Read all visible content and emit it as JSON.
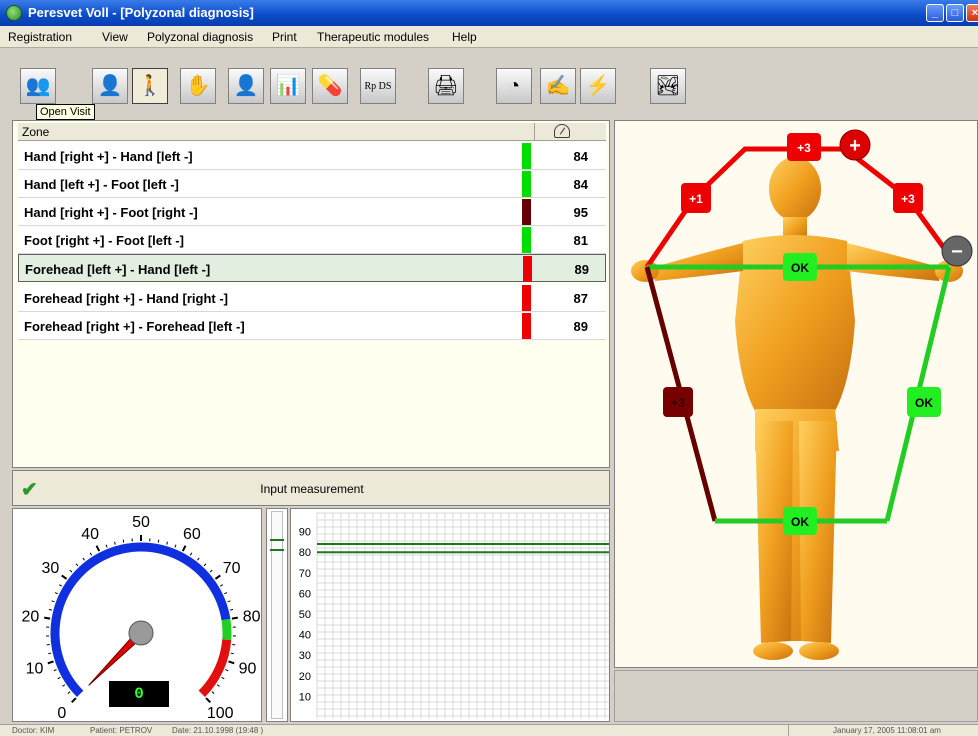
{
  "window": {
    "title": "Peresvet Voll - [Polyzonal diagnosis]"
  },
  "menu": [
    "Registration",
    "View",
    "Polyzonal diagnosis",
    "Print",
    "Therapeutic modules",
    "Help"
  ],
  "toolbar": {
    "tooltip": "Open Visit",
    "buttons": [
      {
        "name": "open-visit-icon",
        "glyph": "👥"
      },
      {
        "name": "patient-icon",
        "glyph": "👤"
      },
      {
        "name": "figure-icon",
        "glyph": "🚶"
      },
      {
        "name": "hand-icon",
        "glyph": "✋"
      },
      {
        "name": "head-profile-icon",
        "glyph": "👤"
      },
      {
        "name": "chart-icon",
        "glyph": "📊"
      },
      {
        "name": "pharmacy-icon",
        "glyph": "💊"
      },
      {
        "name": "prescription-icon",
        "glyph": "Rp DS"
      },
      {
        "name": "printer-icon",
        "glyph": "🖨"
      },
      {
        "name": "gauge-icon",
        "glyph": "◔"
      },
      {
        "name": "acupuncture-icon",
        "glyph": "✍"
      },
      {
        "name": "lightning-icon",
        "glyph": "⚡"
      },
      {
        "name": "landscape-icon",
        "glyph": "🏞"
      }
    ]
  },
  "zones": {
    "header": {
      "zone": "Zone"
    },
    "rows": [
      {
        "name": "Hand [right +] - Hand [left  -]",
        "value": "84",
        "color": "#00dd00"
      },
      {
        "name": "Hand [left   +] - Foot [left   -]",
        "value": "84",
        "color": "#00dd00"
      },
      {
        "name": "Hand [right +] - Foot [right -]",
        "value": "95",
        "color": "#660000"
      },
      {
        "name": "Foot [right  +] - Foot [left   -]",
        "value": "81",
        "color": "#00dd00"
      },
      {
        "name": "Forehead [left   +] - Hand [left   -]",
        "value": "89",
        "color": "#ee0000"
      },
      {
        "name": "Forehead [right +] - Hand [right -]",
        "value": "87",
        "color": "#ee0000"
      },
      {
        "name": "Forehead [right +] - Forehead [left -]",
        "value": "89",
        "color": "#ee0000"
      }
    ]
  },
  "measurement": {
    "label": "Input measurement"
  },
  "gauge": {
    "ticks": [
      "0",
      "10",
      "20",
      "30",
      "40",
      "50",
      "60",
      "70",
      "80",
      "90",
      "100"
    ],
    "readout": "0",
    "needle_value": 0
  },
  "graph": {
    "yticks": [
      "90",
      "80",
      "70",
      "60",
      "50",
      "40",
      "30",
      "20",
      "10"
    ],
    "levels": [
      84,
      80
    ]
  },
  "body_diagram": {
    "badges": {
      "top": "+3",
      "upper_left": "+1",
      "upper_right": "+3",
      "center_arms": "OK",
      "left_side": "+3",
      "right_side": "OK",
      "bottom": "OK"
    },
    "plus_symbol": "+",
    "minus_symbol": "−"
  },
  "statusbar": {
    "doctor": "Doctor: KIM",
    "patient": "Patient: PETROV",
    "date": "Date: 21.10.1998  (19:48 )",
    "datetime": "January 17, 2005 11:08:01 am"
  }
}
